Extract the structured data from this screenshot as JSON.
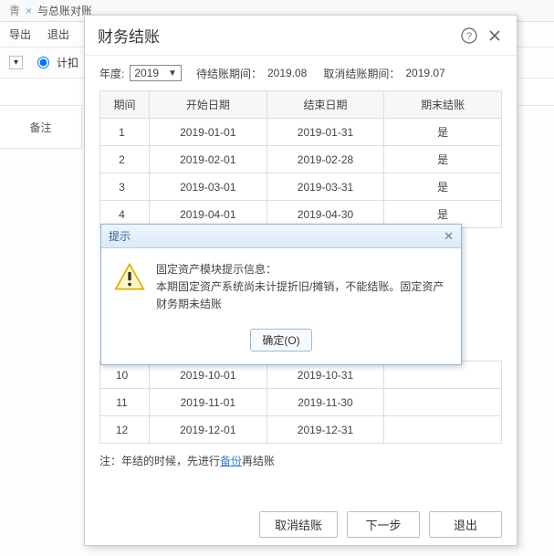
{
  "background": {
    "tab_text": "与总账对账",
    "tab_close": "×",
    "toolbar": {
      "export": "导出",
      "exit": "退出"
    },
    "row_chev": "▾",
    "radio_label": "计扣",
    "remark_header": "备注"
  },
  "modal": {
    "title": "财务结账",
    "year_label": "年度:",
    "year_value": "2019",
    "pending_label": "待结账期间：",
    "pending_value": "2019.08",
    "cancel_label": "取消结账期间：",
    "cancel_value": "2019.07",
    "columns": {
      "period": "期间",
      "start": "开始日期",
      "end": "结束日期",
      "closed": "期末结账"
    },
    "rows": [
      {
        "period": "1",
        "start": "2019-01-01",
        "end": "2019-01-31",
        "closed": "是"
      },
      {
        "period": "2",
        "start": "2019-02-01",
        "end": "2019-02-28",
        "closed": "是"
      },
      {
        "period": "3",
        "start": "2019-03-01",
        "end": "2019-03-31",
        "closed": "是"
      },
      {
        "period": "4",
        "start": "2019-04-01",
        "end": "2019-04-30",
        "closed": "是"
      },
      {
        "period": "10",
        "start": "2019-10-01",
        "end": "2019-10-31",
        "closed": ""
      },
      {
        "period": "11",
        "start": "2019-11-01",
        "end": "2019-11-30",
        "closed": ""
      },
      {
        "period": "12",
        "start": "2019-12-01",
        "end": "2019-12-31",
        "closed": ""
      }
    ],
    "note_prefix": "注：年结的时候，先进行",
    "note_link": "备份",
    "note_suffix": "再结账",
    "buttons": {
      "cancel_close": "取消结账",
      "next": "下一步",
      "exit": "退出"
    }
  },
  "alert": {
    "title": "提示",
    "line1": "固定资产模块提示信息：",
    "line2": "本期固定资产系统尚未计提折旧/摊销，不能结账。固定资产财务期未结账",
    "ok": "确定(O)"
  }
}
